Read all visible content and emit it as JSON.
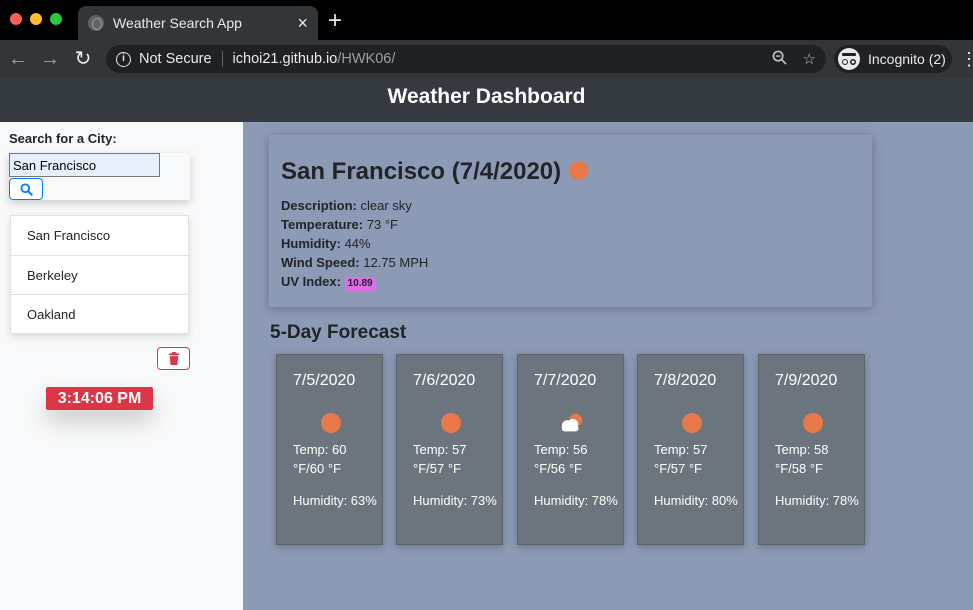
{
  "browser": {
    "tab_title": "Weather Search App",
    "tab_close": "×",
    "new_tab": "+",
    "security_label": "Not Secure",
    "url_host": "ichoi21.github.io",
    "url_path": "/HWK06/",
    "incognito_label": "Incognito (2)"
  },
  "header": {
    "title": "Weather Dashboard"
  },
  "sidebar": {
    "search_label": "Search for a City:",
    "search_value": "San Francisco",
    "cities": [
      "San Francisco",
      "Berkeley",
      "Oakland"
    ],
    "clock": "3:14:06 PM"
  },
  "current": {
    "title": "San Francisco (7/4/2020)",
    "icon": "clear-sky",
    "description_label": "Description:",
    "description": "clear sky",
    "temperature_label": "Temperature:",
    "temperature": "73 °F",
    "humidity_label": "Humidity:",
    "humidity": "44%",
    "wind_label": "Wind Speed:",
    "wind": "12.75 MPH",
    "uv_label": "UV Index:",
    "uv": "10.89"
  },
  "forecast": {
    "title": "5-Day Forecast",
    "days": [
      {
        "date": "7/5/2020",
        "icon": "clear-sky",
        "temp": "Temp: 60 °F/60 °F",
        "humidity": "Humidity: 63%"
      },
      {
        "date": "7/6/2020",
        "icon": "clear-sky",
        "temp": "Temp: 57 °F/57 °F",
        "humidity": "Humidity: 73%"
      },
      {
        "date": "7/7/2020",
        "icon": "few-clouds",
        "temp": "Temp: 56 °F/56 °F",
        "humidity": "Humidity: 78%"
      },
      {
        "date": "7/8/2020",
        "icon": "clear-sky",
        "temp": "Temp: 57 °F/57 °F",
        "humidity": "Humidity: 80%"
      },
      {
        "date": "7/9/2020",
        "icon": "clear-sky",
        "temp": "Temp: 58 °F/58 °F",
        "humidity": "Humidity: 78%"
      }
    ]
  },
  "colors": {
    "header_bg": "#343a40",
    "main_bg": "#8d9ab5",
    "card_bg": "#6c757d",
    "clock_bg": "#dc3545",
    "uv_badge": "#e06ce8",
    "sun": "#e8784a"
  }
}
